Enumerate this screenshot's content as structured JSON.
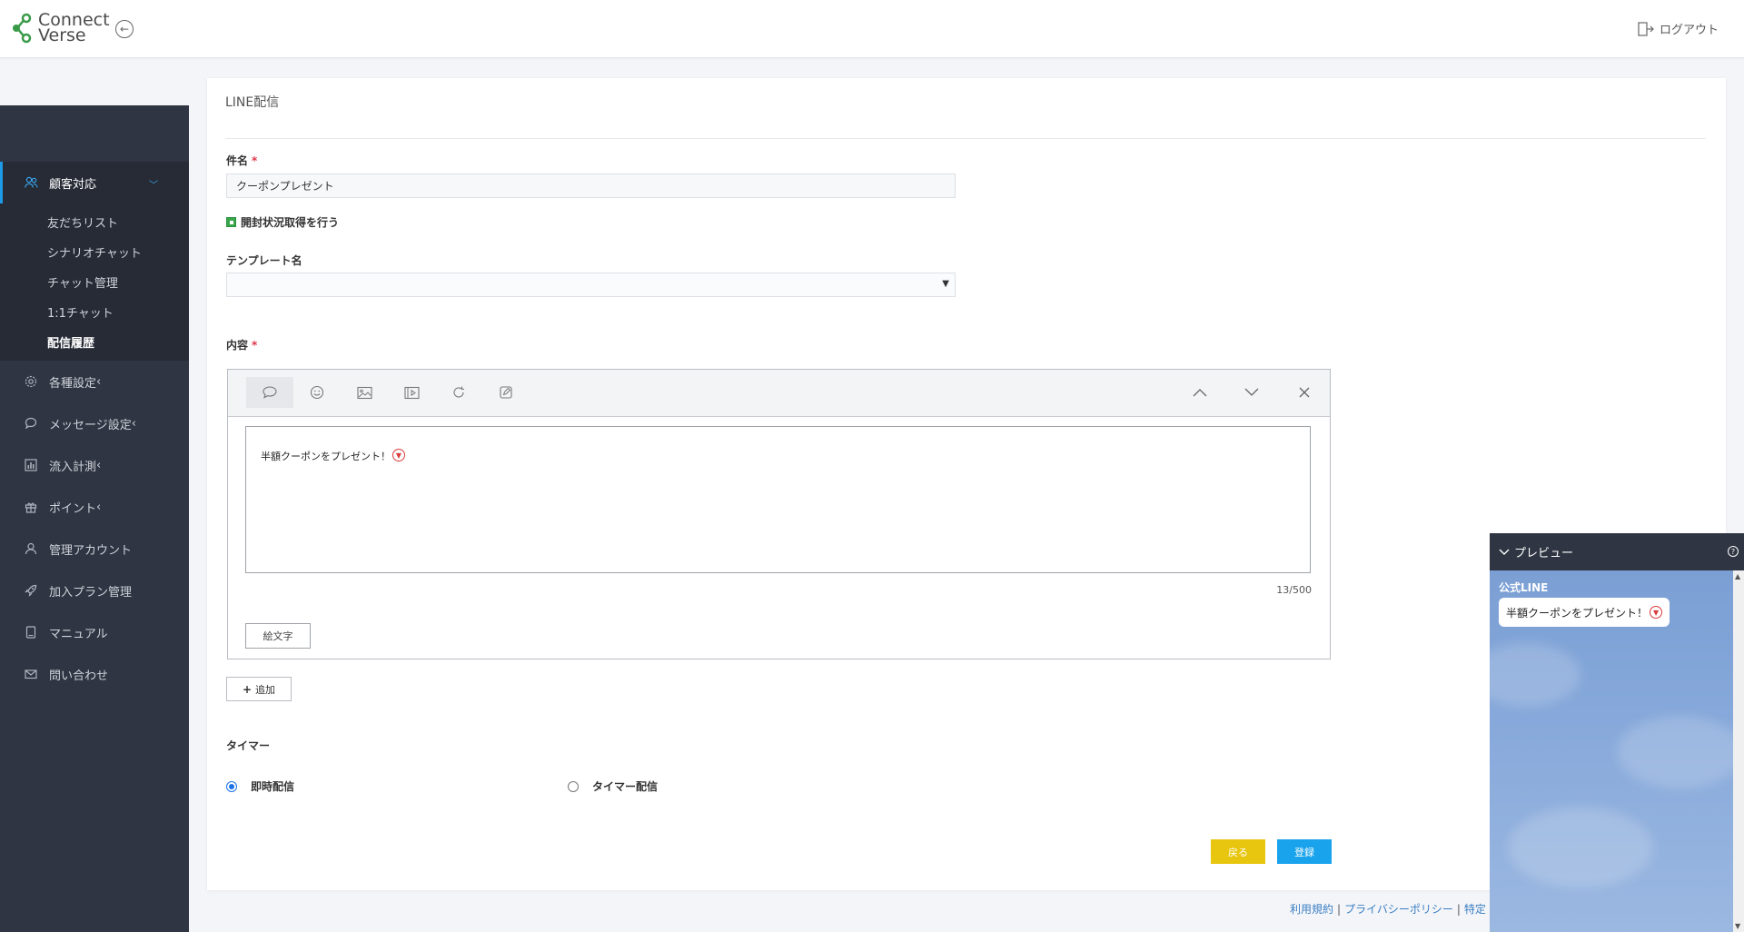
{
  "header": {
    "logo_line1": "Connect",
    "logo_line2": "Verse",
    "logout_label": "ログアウト"
  },
  "sidebar": {
    "parent_items": [
      {
        "label": "顧客対応",
        "icon": "people-icon"
      },
      {
        "label": "各種設定",
        "icon": "gear-icon",
        "suffix": "‹"
      },
      {
        "label": "メッセージ設定",
        "icon": "chat-bubble-icon",
        "suffix": "‹"
      },
      {
        "label": "流入計測",
        "icon": "bar-chart-icon",
        "suffix": "‹"
      },
      {
        "label": "ポイント",
        "icon": "gift-icon",
        "suffix": "‹"
      },
      {
        "label": "管理アカウント",
        "icon": "user-icon"
      },
      {
        "label": "加入プラン管理",
        "icon": "rocket-icon"
      },
      {
        "label": "マニュアル",
        "icon": "book-icon"
      },
      {
        "label": "問い合わせ",
        "icon": "mail-icon"
      }
    ],
    "sub_items": [
      "友だちリスト",
      "シナリオチャット",
      "チャット管理",
      "1:1チャット",
      "配信履歴"
    ]
  },
  "main": {
    "title": "LINE配信",
    "subject_label": "件名",
    "required_mark": "*",
    "subject_value": "クーポンプレゼント",
    "open_tracking_label": "開封状況取得を行う",
    "template_label": "テンプレート名",
    "template_value": "",
    "content_label": "内容",
    "message_text": "半額クーポンをプレゼント！",
    "char_count": "13/500",
    "emoji_button": "絵文字",
    "add_button": "追加",
    "timer_label": "タイマー",
    "radio_immediate": "即時配信",
    "radio_timer": "タイマー配信",
    "back_button": "戻る",
    "submit_button": "登録"
  },
  "footer": {
    "links": [
      "利用規約",
      "プライバシーポリシー",
      "特定"
    ]
  },
  "preview": {
    "title": "プレビュー",
    "account_name": "公式LINE",
    "message_text": "半額クーポンをプレゼント！"
  },
  "colors": {
    "sidebar_bg": "#2f3542",
    "accent_blue": "#19a3ec",
    "back_yellow": "#e8c60f",
    "check_green": "#38a74b",
    "required_red": "#e0344a"
  }
}
